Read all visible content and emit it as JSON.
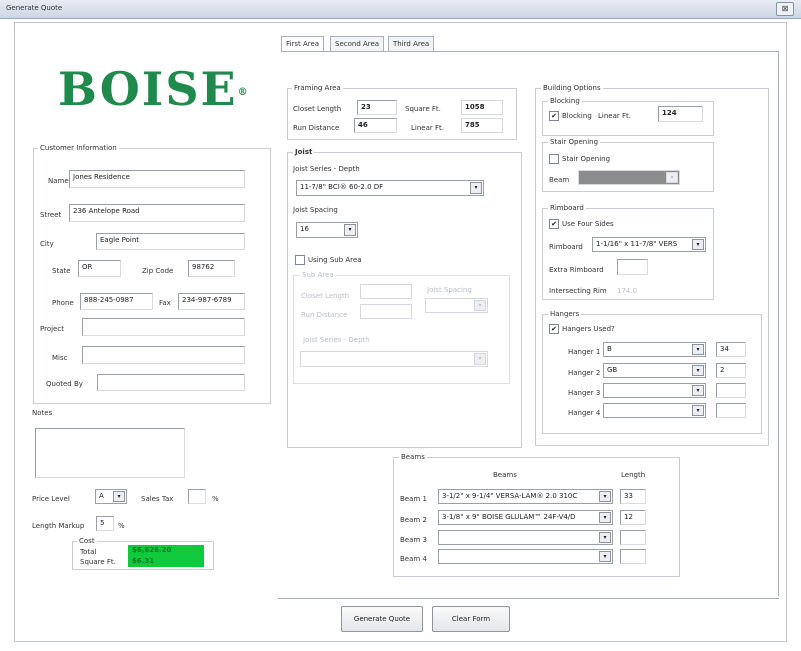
{
  "window": {
    "title": "Generate Quote",
    "close_glyph": "⊠"
  },
  "tabs": [
    {
      "label": "First Area"
    },
    {
      "label": "Second Area"
    },
    {
      "label": "Third Area"
    }
  ],
  "logo": {
    "text": "BOISE",
    "reg": "®",
    "color": "#1f8a4c"
  },
  "customer": {
    "title": "Customer Information",
    "name_label": "Name",
    "name": "Jones Residence",
    "street_label": "Street",
    "street": "236 Antelope Road",
    "city_label": "City",
    "city": "Eagle Point",
    "state_label": "State",
    "state": "OR",
    "zip_label": "Zip Code",
    "zip": "98762",
    "phone_label": "Phone",
    "phone": "888-245-0987",
    "fax_label": "Fax",
    "fax": "234-987-6789",
    "project_label": "Project",
    "project": "",
    "misc_label": "Misc",
    "misc": "",
    "quoted_by_label": "Quoted By",
    "quoted_by": ""
  },
  "notes": {
    "label": "Notes",
    "value": ""
  },
  "pricing": {
    "price_level_label": "Price Level",
    "price_level": "A",
    "sales_tax_label": "Sales Tax",
    "sales_tax": "",
    "pct": "%",
    "markup_label": "Length Markup",
    "markup": "5",
    "markup_pct": "%"
  },
  "cost": {
    "title": "Cost",
    "total_label": "Total",
    "total": "$6,626.20",
    "sqft_label": "Square Ft.",
    "sqft": "$6.31"
  },
  "framing": {
    "title": "Framing Area",
    "closet_label": "Closet Length",
    "closet": "23",
    "run_label": "Run Distance",
    "run": "46",
    "sqft_label": "Square Ft.",
    "sqft": "1058",
    "linft_label": "Linear Ft.",
    "linft": "785"
  },
  "joist": {
    "title": "Joist",
    "series_label": "Joist Series - Depth",
    "series": "11-7/8\" BCI® 60-2.0 DF",
    "spacing_label": "Joist Spacing",
    "spacing": "16",
    "sub_area_label": "Using Sub Area",
    "sub_title": "Sub Area",
    "sub_closet_label": "Closet Length",
    "sub_spacing_label": "Joist Spacing",
    "sub_run_label": "Run Distance",
    "sub_series_label": "Joist Series - Depth"
  },
  "building": {
    "title": "Building Options",
    "blocking_title": "Blocking",
    "blocking_chk": "Blocking",
    "blocking_linft_label": "Linear Ft.",
    "blocking_linft": "124",
    "stair_title": "Stair Opening",
    "stair_chk": "Stair Opening",
    "beam_label": "Beam",
    "rim_title": "Rimboard",
    "rim_chk": "Use Four Sides",
    "rim_label": "Rimboard",
    "rim": "1-1/16\" x 11-7/8\" VERS",
    "extra_label": "Extra Rimboard",
    "intersect_label": "Intersecting Rim",
    "intersect_val": "174.0"
  },
  "hangers": {
    "title": "Hangers",
    "used_label": "Hangers Used?",
    "rows": [
      {
        "label": "Hanger 1",
        "type": "B",
        "qty": "34"
      },
      {
        "label": "Hanger 2",
        "type": "GB",
        "qty": "2"
      },
      {
        "label": "Hanger 3",
        "type": "",
        "qty": ""
      },
      {
        "label": "Hanger 4",
        "type": "",
        "qty": ""
      }
    ]
  },
  "beams": {
    "title": "Beams",
    "col_beams": "Beams",
    "col_length": "Length",
    "rows": [
      {
        "label": "Beam 1",
        "beam": "3-1/2\" x 9-1/4\" VERSA-LAM® 2.0 310C",
        "length": "33"
      },
      {
        "label": "Beam 2",
        "beam": "3-1/8\" x 9\" BOISE GLULAM™ 24F-V4/D",
        "length": "12"
      },
      {
        "label": "Beam 3",
        "beam": "",
        "length": ""
      },
      {
        "label": "Beam 4",
        "beam": "",
        "length": ""
      }
    ]
  },
  "buttons": {
    "generate": "Generate Quote",
    "clear": "Clear Form"
  },
  "glyphs": {
    "check": "✔",
    "arrow": "▾"
  }
}
